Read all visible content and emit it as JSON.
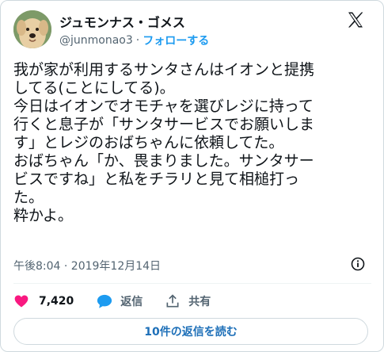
{
  "author": {
    "display_name": "ジュモンナス・ゴメス",
    "handle": "@junmonao3",
    "separator": "·",
    "follow_label": "フォローする"
  },
  "tweet": {
    "lines": [
      "我が家が利用するサンタさんはイオンと提携",
      "してる(ことにしてる)。",
      "今日はイオンでオモチャを選びレジに持って",
      "行くと息子が「サンタサービスでお願いしま",
      "す」とレジのおばちゃんに依頼してた。",
      "おばちゃん「か、畏まりました。サンタサー",
      "ビスですね」と私をチラリと見て相槌打っ",
      "た。",
      "粋かよ。"
    ],
    "timestamp": "午後8:04 · 2019年12月14日"
  },
  "actions": {
    "like_count": "7,420",
    "reply_label": "返信",
    "share_label": "共有"
  },
  "read_replies_label": "10件の返信を読む",
  "icons": {
    "logo": "x-logo-icon",
    "like": "heart-icon",
    "reply": "speech-bubble-icon",
    "share": "share-arrow-icon",
    "info": "info-icon"
  },
  "colors": {
    "like": "#f91880",
    "reply": "#1d9bf0",
    "link": "#1d9bf0",
    "secondary_text": "#536471"
  }
}
